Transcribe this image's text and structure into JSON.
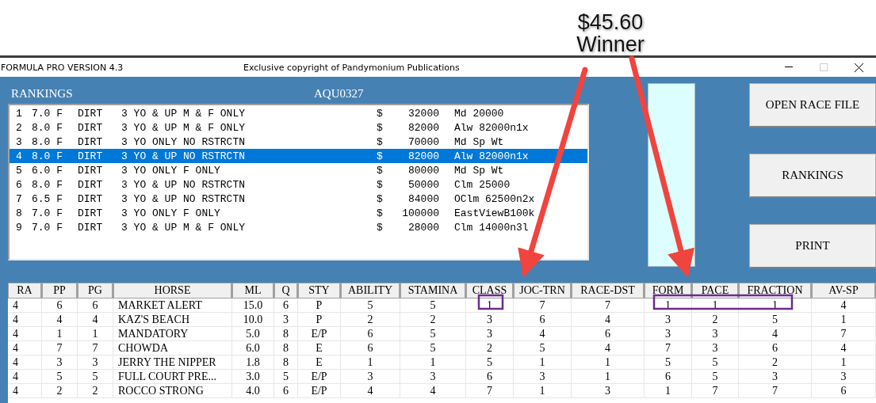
{
  "annotation": {
    "price": "$45.60",
    "label": "Winner"
  },
  "window": {
    "title": "FORMULA PRO VERSION 4.3",
    "copyright": "Exclusive copyright of Pandymonium Publications"
  },
  "panel": {
    "title": "RANKINGS",
    "race_code": "AQU0327"
  },
  "races": [
    {
      "number": "1",
      "distance": "7.0 F",
      "surface": "DIRT",
      "conditions": "3 YO & UP M & F ONLY",
      "currency": "$",
      "purse": "32000",
      "race_class": "Md 20000",
      "selected": false
    },
    {
      "number": "2",
      "distance": "8.0 F",
      "surface": "DIRT",
      "conditions": "3 YO & UP M & F ONLY",
      "currency": "$",
      "purse": "82000",
      "race_class": "Alw 82000n1x",
      "selected": false
    },
    {
      "number": "3",
      "distance": "8.0 F",
      "surface": "DIRT",
      "conditions": "3 YO ONLY NO RSTRCTN",
      "currency": "$",
      "purse": "70000",
      "race_class": "Md Sp Wt",
      "selected": false
    },
    {
      "number": "4",
      "distance": "8.0 F",
      "surface": "DIRT",
      "conditions": "3 YO & UP NO RSTRCTN",
      "currency": "$",
      "purse": "82000",
      "race_class": "Alw 82000n1x",
      "selected": true
    },
    {
      "number": "5",
      "distance": "6.0 F",
      "surface": "DIRT",
      "conditions": "3 YO ONLY F ONLY",
      "currency": "$",
      "purse": "80000",
      "race_class": "Md Sp Wt",
      "selected": false
    },
    {
      "number": "6",
      "distance": "8.0 F",
      "surface": "DIRT",
      "conditions": "3 YO & UP NO RSTRCTN",
      "currency": "$",
      "purse": "50000",
      "race_class": "Clm 25000",
      "selected": false
    },
    {
      "number": "7",
      "distance": "6.5 F",
      "surface": "DIRT",
      "conditions": "3 YO & UP NO RSTRCTN",
      "currency": "$",
      "purse": "84000",
      "race_class": "OClm 62500n2x",
      "selected": false
    },
    {
      "number": "8",
      "distance": "7.0 F",
      "surface": "DIRT",
      "conditions": "3 YO ONLY F ONLY",
      "currency": "$",
      "purse": "100000",
      "race_class": "EastViewB100k",
      "selected": false
    },
    {
      "number": "9",
      "distance": "7.0 F",
      "surface": "DIRT",
      "conditions": "3 YO & UP M & F ONLY",
      "currency": "$",
      "purse": "28000",
      "race_class": "Clm 14000n3l",
      "selected": false
    }
  ],
  "buttons": [
    "OPEN RACE FILE",
    "RANKINGS",
    "PRINT"
  ],
  "table": {
    "columns": [
      "RA",
      "PP",
      "PG",
      "HORSE",
      "ML",
      "Q",
      "STY",
      "ABILITY",
      "STAMINA",
      "CLASS",
      "JOC-TRN",
      "RACE-DST",
      "FORM",
      "PACE",
      "FRACTION",
      "AV-SP"
    ],
    "rows": [
      [
        "4",
        "6",
        "6",
        "MARKET ALERT",
        "15.0",
        "6",
        "P",
        "5",
        "5",
        "1",
        "7",
        "7",
        "1",
        "1",
        "1",
        "4"
      ],
      [
        "4",
        "4",
        "4",
        "KAZ'S BEACH",
        "10.0",
        "3",
        "P",
        "2",
        "2",
        "3",
        "6",
        "4",
        "3",
        "2",
        "5",
        "1"
      ],
      [
        "4",
        "1",
        "1",
        "MANDATORY",
        "5.0",
        "8",
        "E/P",
        "6",
        "5",
        "3",
        "4",
        "6",
        "3",
        "3",
        "4",
        "7"
      ],
      [
        "4",
        "7",
        "7",
        "CHOWDA",
        "6.0",
        "8",
        "E",
        "6",
        "5",
        "2",
        "5",
        "4",
        "7",
        "3",
        "6",
        "4"
      ],
      [
        "4",
        "3",
        "3",
        "JERRY THE NIPPER",
        "1.8",
        "8",
        "E",
        "1",
        "1",
        "5",
        "1",
        "1",
        "5",
        "5",
        "2",
        "1"
      ],
      [
        "4",
        "5",
        "5",
        "FULL COURT PRE...",
        "3.0",
        "5",
        "E/P",
        "3",
        "3",
        "6",
        "3",
        "1",
        "6",
        "5",
        "3",
        "3"
      ],
      [
        "4",
        "2",
        "2",
        "ROCCO STRONG",
        "4.0",
        "6",
        "E/P",
        "4",
        "4",
        "7",
        "1",
        "3",
        "1",
        "7",
        "7",
        "6"
      ]
    ]
  }
}
